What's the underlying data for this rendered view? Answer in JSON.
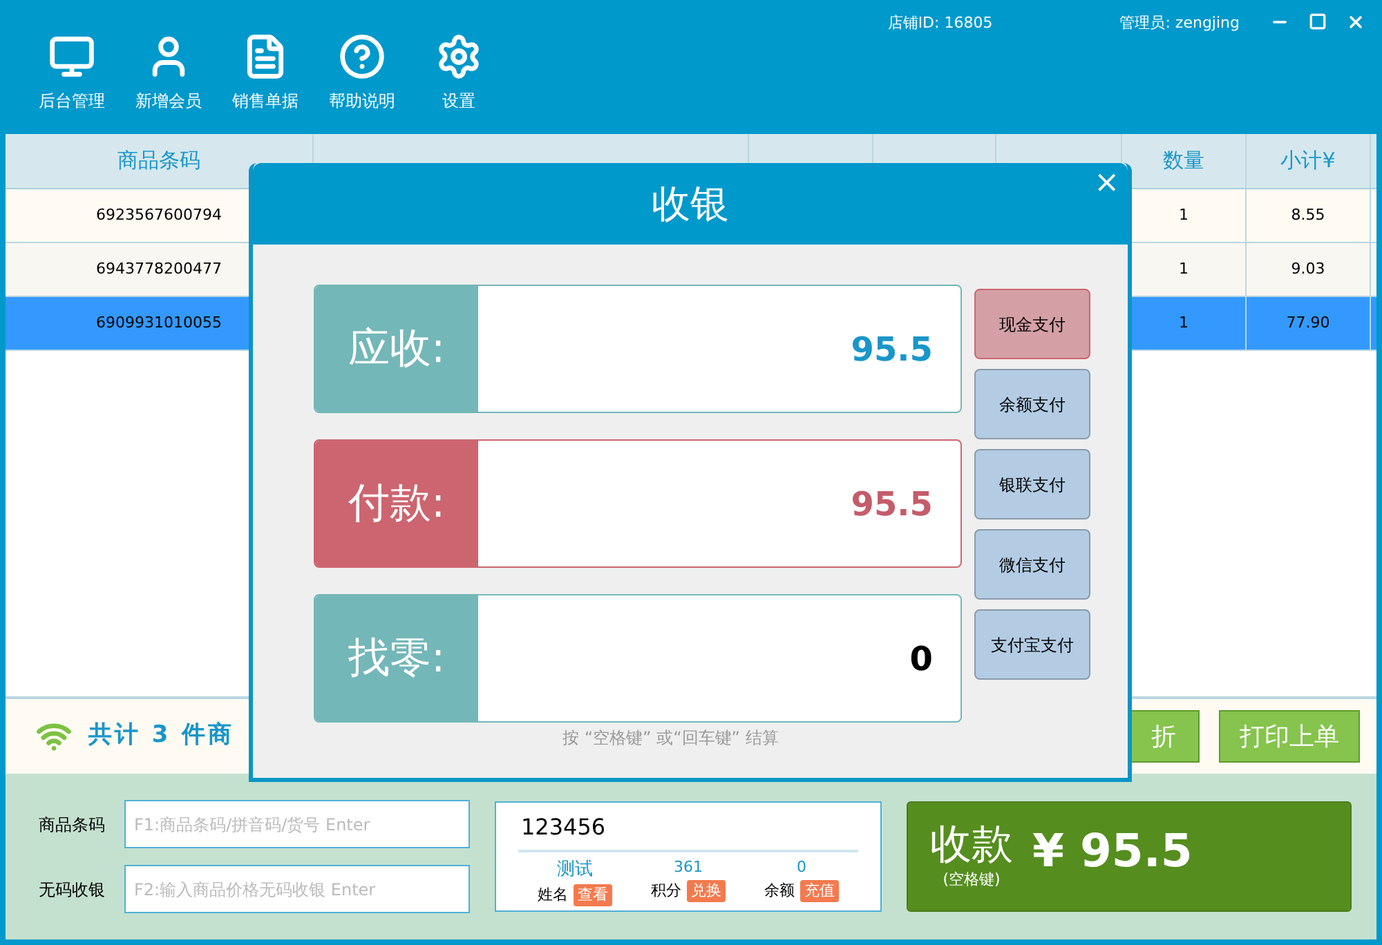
{
  "toolbar": [
    {
      "kind": "monitor",
      "label": "后台管理"
    },
    {
      "kind": "user",
      "label": "新增会员"
    },
    {
      "kind": "document",
      "label": "销售单据"
    },
    {
      "kind": "help",
      "label": "帮助说明"
    },
    {
      "kind": "settings",
      "label": "设置"
    }
  ],
  "store_id": "店铺ID: 16805",
  "admin": "管理员: zengjing",
  "table": {
    "columns": [
      "商品条码",
      "",
      "",
      "",
      "",
      "数量",
      "小计¥"
    ],
    "rows": [
      {
        "barcode": "6923567600794",
        "quantity": "1",
        "subtotal": "8.55",
        "selected": false
      },
      {
        "barcode": "6943778200477",
        "quantity": "1",
        "subtotal": "9.03",
        "selected": false
      },
      {
        "barcode": "6909931010055",
        "quantity": "1",
        "subtotal": "77.90",
        "selected": true
      }
    ]
  },
  "summary": {
    "text": "共计 3 件商",
    "buttons": [
      "折",
      "打印上单"
    ]
  },
  "inputs": [
    {
      "label": "商品条码",
      "placeholder": "F1:商品条码/拼音码/货号 Enter"
    },
    {
      "label": "无码收银",
      "placeholder": "F2:输入商品价格无码收银 Enter"
    }
  ],
  "member": {
    "value": "123456",
    "stats": [
      {
        "value": "测试",
        "label": "姓名",
        "action": "查看"
      },
      {
        "value": "361",
        "label": "积分",
        "action": "兑换"
      },
      {
        "value": "0",
        "label": "余额",
        "action": "充值"
      }
    ]
  },
  "checkout": {
    "label": "收款",
    "hint": "(空格键)",
    "amount": "¥ 95.5"
  },
  "dialog": {
    "title": "收银",
    "close": "×",
    "amounts": [
      {
        "kind": "receivable",
        "label": "应收:",
        "value": "95.5"
      },
      {
        "kind": "paid",
        "label": "付款:",
        "value": "95.5"
      },
      {
        "kind": "change",
        "label": "找零:",
        "value": "0"
      }
    ],
    "payment_methods": [
      {
        "label": "现金支付",
        "selected": true
      },
      {
        "label": "余额支付",
        "selected": false
      },
      {
        "label": "银联支付",
        "selected": false
      },
      {
        "label": "微信支付",
        "selected": false
      },
      {
        "label": "支付宝支付",
        "selected": false
      }
    ],
    "hint": "按 “空格键” 或“回车键” 结算"
  }
}
